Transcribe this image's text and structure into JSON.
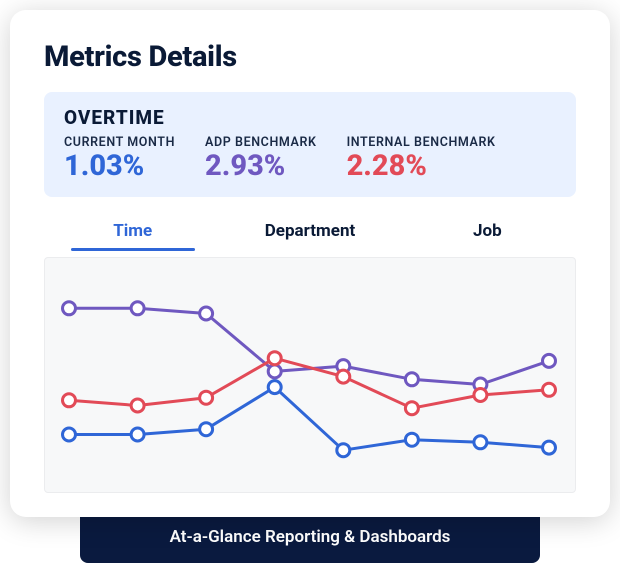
{
  "title": "Metrics Details",
  "summary": {
    "heading": "OVERTIME",
    "metrics": [
      {
        "label": "CURRENT MONTH",
        "value": "1.03%",
        "color_class": "mv-blue"
      },
      {
        "label": "ADP BENCHMARK",
        "value": "2.93%",
        "color_class": "mv-purple"
      },
      {
        "label": "INTERNAL BENCHMARK",
        "value": "2.28%",
        "color_class": "mv-red"
      }
    ]
  },
  "tabs": [
    {
      "label": "Time",
      "active": true
    },
    {
      "label": "Department",
      "active": false
    },
    {
      "label": "Job",
      "active": false
    }
  ],
  "caption": "At-a-Glance Reporting & Dashboards",
  "chart_data": {
    "type": "line",
    "title": "",
    "xlabel": "",
    "ylabel": "",
    "ylim": [
      0,
      3.5
    ],
    "x": [
      1,
      2,
      3,
      4,
      5,
      6,
      7,
      8
    ],
    "series": [
      {
        "name": "Current Month",
        "color": "#2f66d7",
        "values": [
          0.6,
          0.6,
          0.7,
          1.5,
          0.3,
          0.5,
          0.45,
          0.35
        ]
      },
      {
        "name": "ADP Benchmark",
        "color": "#6f58c0",
        "values": [
          3.0,
          3.0,
          2.9,
          1.8,
          1.9,
          1.65,
          1.55,
          2.0
        ]
      },
      {
        "name": "Internal Benchmark",
        "color": "#e24a57",
        "values": [
          1.25,
          1.15,
          1.3,
          2.05,
          1.7,
          1.1,
          1.35,
          1.45
        ]
      }
    ]
  }
}
